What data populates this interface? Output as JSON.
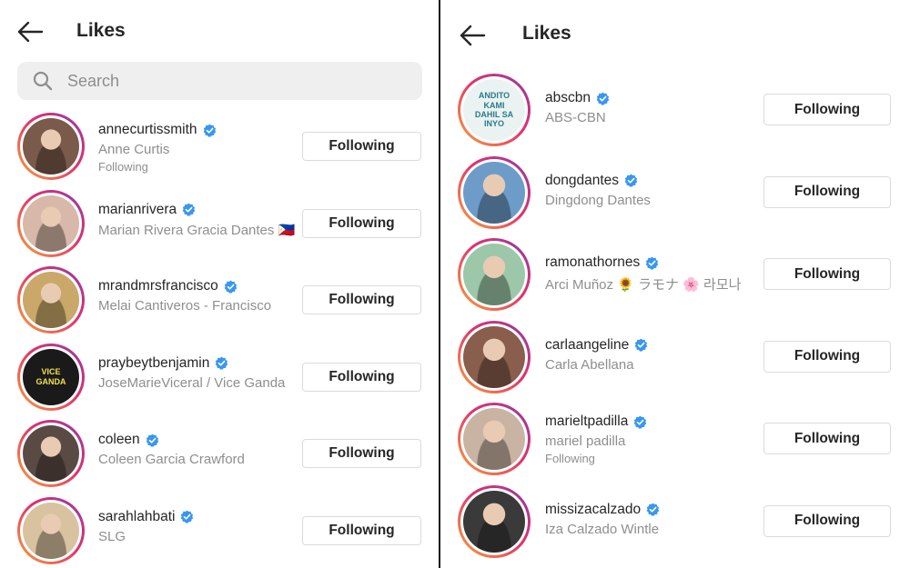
{
  "left": {
    "title": "Likes",
    "search": {
      "placeholder": "Search"
    },
    "users": [
      {
        "username": "annecurtissmith",
        "fullname": "Anne Curtis",
        "sub": "Following",
        "button": "Following",
        "avatar_color": "#7a5a4a"
      },
      {
        "username": "marianrivera",
        "fullname": "Marian Rivera Gracia Dantes 🇵🇭",
        "sub": "",
        "button": "Following",
        "avatar_color": "#d8b8a8"
      },
      {
        "username": "mrandmrsfrancisco",
        "fullname": "Melai Cantiveros - Francisco",
        "sub": "",
        "button": "Following",
        "avatar_color": "#c9a86a"
      },
      {
        "username": "praybeytbenjamin",
        "fullname": "JoseMarieViceral / Vice Ganda",
        "sub": "",
        "button": "Following",
        "avatar_color": "#1a1a1a",
        "logo_text": "VICE GANDA"
      },
      {
        "username": "coleen",
        "fullname": "Coleen Garcia Crawford",
        "sub": "",
        "button": "Following",
        "avatar_color": "#5a4a44"
      },
      {
        "username": "sarahlahbati",
        "fullname": "SLG",
        "sub": "",
        "button": "Following",
        "avatar_color": "#d9c2a0"
      }
    ]
  },
  "right": {
    "title": "Likes",
    "users": [
      {
        "username": "abscbn",
        "fullname": "ABS-CBN",
        "sub": "",
        "button": "Following",
        "avatar_color": "#eaf3f2",
        "logo_text": "ANDITO KAMI DAHIL SA INYO"
      },
      {
        "username": "dongdantes",
        "fullname": "Dingdong Dantes",
        "sub": "",
        "button": "Following",
        "avatar_color": "#6d9cc9"
      },
      {
        "username": "ramonathornes",
        "fullname": "Arci Muñoz 🌻 ラモナ 🌸 라모나",
        "sub": "",
        "button": "Following",
        "avatar_color": "#9cc7a8"
      },
      {
        "username": "carlaangeline",
        "fullname": "Carla Abellana",
        "sub": "",
        "button": "Following",
        "avatar_color": "#8a5e4c"
      },
      {
        "username": "marieltpadilla",
        "fullname": "mariel padilla",
        "sub": "Following",
        "button": "Following",
        "avatar_color": "#c9b3a2"
      },
      {
        "username": "missizacalzado",
        "fullname": "Iza Calzado Wintle",
        "sub": "",
        "button": "Following",
        "avatar_color": "#3a3a3a"
      }
    ]
  },
  "colors": {
    "verified": "#3897f0",
    "secondary_text": "#8e8e8e",
    "button_border": "#dbdbdb"
  },
  "icons": {
    "back": "back-arrow-icon",
    "search": "search-icon",
    "verified": "verified-badge-icon"
  }
}
